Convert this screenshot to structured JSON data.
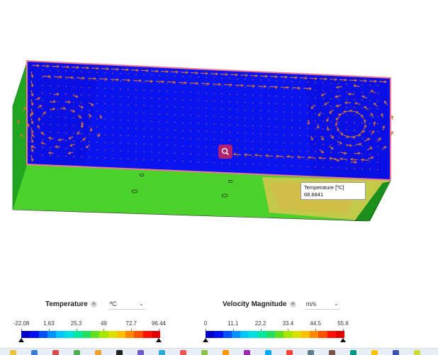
{
  "viewport": {
    "tooltip": {
      "line1": "Temperature [ºC]",
      "line2": "68.6841"
    },
    "zoom_icon": "zoom-search-icon"
  },
  "legend_temperature": {
    "title": "Temperature",
    "info_icon": "info-icon",
    "unit": "ºC",
    "ticks": [
      "-22.08",
      "1.63",
      "25.3",
      "49",
      "72.7",
      "96.44"
    ],
    "min": -22.08,
    "max": 96.44
  },
  "legend_velocity": {
    "title": "Velocity Magnitude",
    "info_icon": "info-icon",
    "unit": "m/s",
    "ticks": [
      "0",
      "11.1",
      "22.2",
      "33.4",
      "44.5",
      "55.6"
    ],
    "min": 0,
    "max": 55.6
  },
  "colormap": [
    "#0000c8",
    "#0010f0",
    "#0050ff",
    "#0090ff",
    "#00c8ff",
    "#00e0e0",
    "#00e8a0",
    "#20e060",
    "#60e020",
    "#a8e800",
    "#e0e000",
    "#ffc000",
    "#ff8800",
    "#ff5000",
    "#ff1000",
    "#e00000"
  ],
  "taskbar": {
    "icons": [
      "app-icon-1",
      "app-icon-2",
      "app-icon-3",
      "app-icon-4",
      "app-icon-5",
      "app-icon-6",
      "app-icon-7",
      "app-icon-8",
      "app-icon-9",
      "app-icon-10",
      "app-icon-11",
      "app-icon-12",
      "app-icon-13",
      "app-icon-14",
      "app-icon-15",
      "app-icon-16",
      "app-icon-17",
      "app-icon-18",
      "app-icon-19",
      "app-icon-20"
    ]
  }
}
